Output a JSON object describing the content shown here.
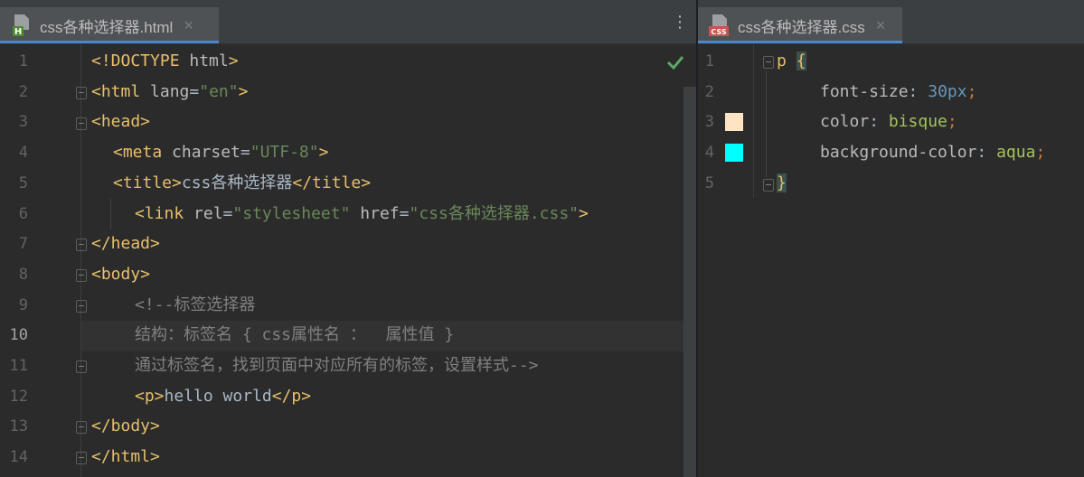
{
  "left_editor": {
    "tab": {
      "title": "css各种选择器.html",
      "close": "×",
      "file_type_icon": "html-file-icon",
      "icon_letter": "H"
    },
    "more_icon": "⋮",
    "inspection_status": "check-icon",
    "current_line": 10,
    "lines": [
      {
        "n": "1",
        "segs": [
          {
            "c": "tag",
            "t": "<!DOCTYPE "
          },
          {
            "c": "attr",
            "t": "html"
          },
          {
            "c": "tag",
            "t": ">"
          }
        ]
      },
      {
        "n": "2",
        "segs": [
          {
            "c": "tag",
            "t": "<html "
          },
          {
            "c": "attr",
            "t": "lang"
          },
          {
            "c": "plain",
            "t": "="
          },
          {
            "c": "val",
            "t": "\"en\""
          },
          {
            "c": "tag",
            "t": ">"
          }
        ]
      },
      {
        "n": "3",
        "segs": [
          {
            "c": "tag",
            "t": "<head>"
          }
        ]
      },
      {
        "n": "4",
        "segs": [
          {
            "c": "tag",
            "t": "<meta "
          },
          {
            "c": "attr",
            "t": "charset"
          },
          {
            "c": "plain",
            "t": "="
          },
          {
            "c": "val",
            "t": "\"UTF-8\""
          },
          {
            "c": "tag",
            "t": ">"
          }
        ]
      },
      {
        "n": "5",
        "segs": [
          {
            "c": "tag",
            "t": "<title>"
          },
          {
            "c": "plain",
            "t": "css各种选择器"
          },
          {
            "c": "tag",
            "t": "</title>"
          }
        ]
      },
      {
        "n": "6",
        "segs": [
          {
            "c": "tag",
            "t": "<link "
          },
          {
            "c": "attr",
            "t": "rel"
          },
          {
            "c": "plain",
            "t": "="
          },
          {
            "c": "val",
            "t": "\"stylesheet\""
          },
          {
            "c": "plain",
            "t": " "
          },
          {
            "c": "attr",
            "t": "href"
          },
          {
            "c": "plain",
            "t": "="
          },
          {
            "c": "val",
            "t": "\"css各种选择器.css\""
          },
          {
            "c": "tag",
            "t": ">"
          }
        ]
      },
      {
        "n": "7",
        "segs": [
          {
            "c": "tag",
            "t": "</head>"
          }
        ]
      },
      {
        "n": "8",
        "segs": [
          {
            "c": "tag",
            "t": "<body>"
          }
        ]
      },
      {
        "n": "9",
        "segs": [
          {
            "c": "cmt",
            "t": "<!--标签选择器"
          }
        ]
      },
      {
        "n": "10",
        "segs": [
          {
            "c": "cmt",
            "t": "结构：标签名 { css属性名 ：  属性值 }"
          }
        ]
      },
      {
        "n": "11",
        "segs": [
          {
            "c": "cmt",
            "t": "通过标签名，找到页面中对应所有的标签，设置样式-->"
          }
        ]
      },
      {
        "n": "12",
        "segs": [
          {
            "c": "tag",
            "t": "<p>"
          },
          {
            "c": "plain",
            "t": "hello world"
          },
          {
            "c": "tag",
            "t": "</p>"
          }
        ]
      },
      {
        "n": "13",
        "segs": [
          {
            "c": "tag",
            "t": "</body>"
          }
        ]
      },
      {
        "n": "14",
        "segs": [
          {
            "c": "tag",
            "t": "</html>"
          }
        ]
      }
    ]
  },
  "right_editor": {
    "tab": {
      "title": "css各种选择器.css",
      "close": "×",
      "file_type_icon": "css-file-icon",
      "icon_label": "CSS"
    },
    "lines": [
      {
        "n": "1",
        "segs": [
          {
            "c": "sel",
            "t": "p "
          },
          {
            "c": "brace",
            "t": "{"
          }
        ]
      },
      {
        "n": "2",
        "segs": [
          {
            "c": "prop",
            "t": "font-size"
          },
          {
            "c": "plain",
            "t": ": "
          },
          {
            "c": "num",
            "t": "30px"
          },
          {
            "c": "semi",
            "t": ";"
          }
        ]
      },
      {
        "n": "3",
        "segs": [
          {
            "c": "prop",
            "t": "color"
          },
          {
            "c": "plain",
            "t": ": "
          },
          {
            "c": "cval",
            "t": "bisque"
          },
          {
            "c": "semi",
            "t": ";"
          }
        ]
      },
      {
        "n": "4",
        "segs": [
          {
            "c": "prop",
            "t": "background-color"
          },
          {
            "c": "plain",
            "t": ": "
          },
          {
            "c": "cval",
            "t": "aqua"
          },
          {
            "c": "semi",
            "t": ";"
          }
        ]
      },
      {
        "n": "5",
        "segs": [
          {
            "c": "brace",
            "t": "}"
          }
        ]
      }
    ],
    "swatches": [
      {
        "line": "3",
        "color": "#ffe4c4"
      },
      {
        "line": "4",
        "color": "#00ffff"
      }
    ]
  }
}
